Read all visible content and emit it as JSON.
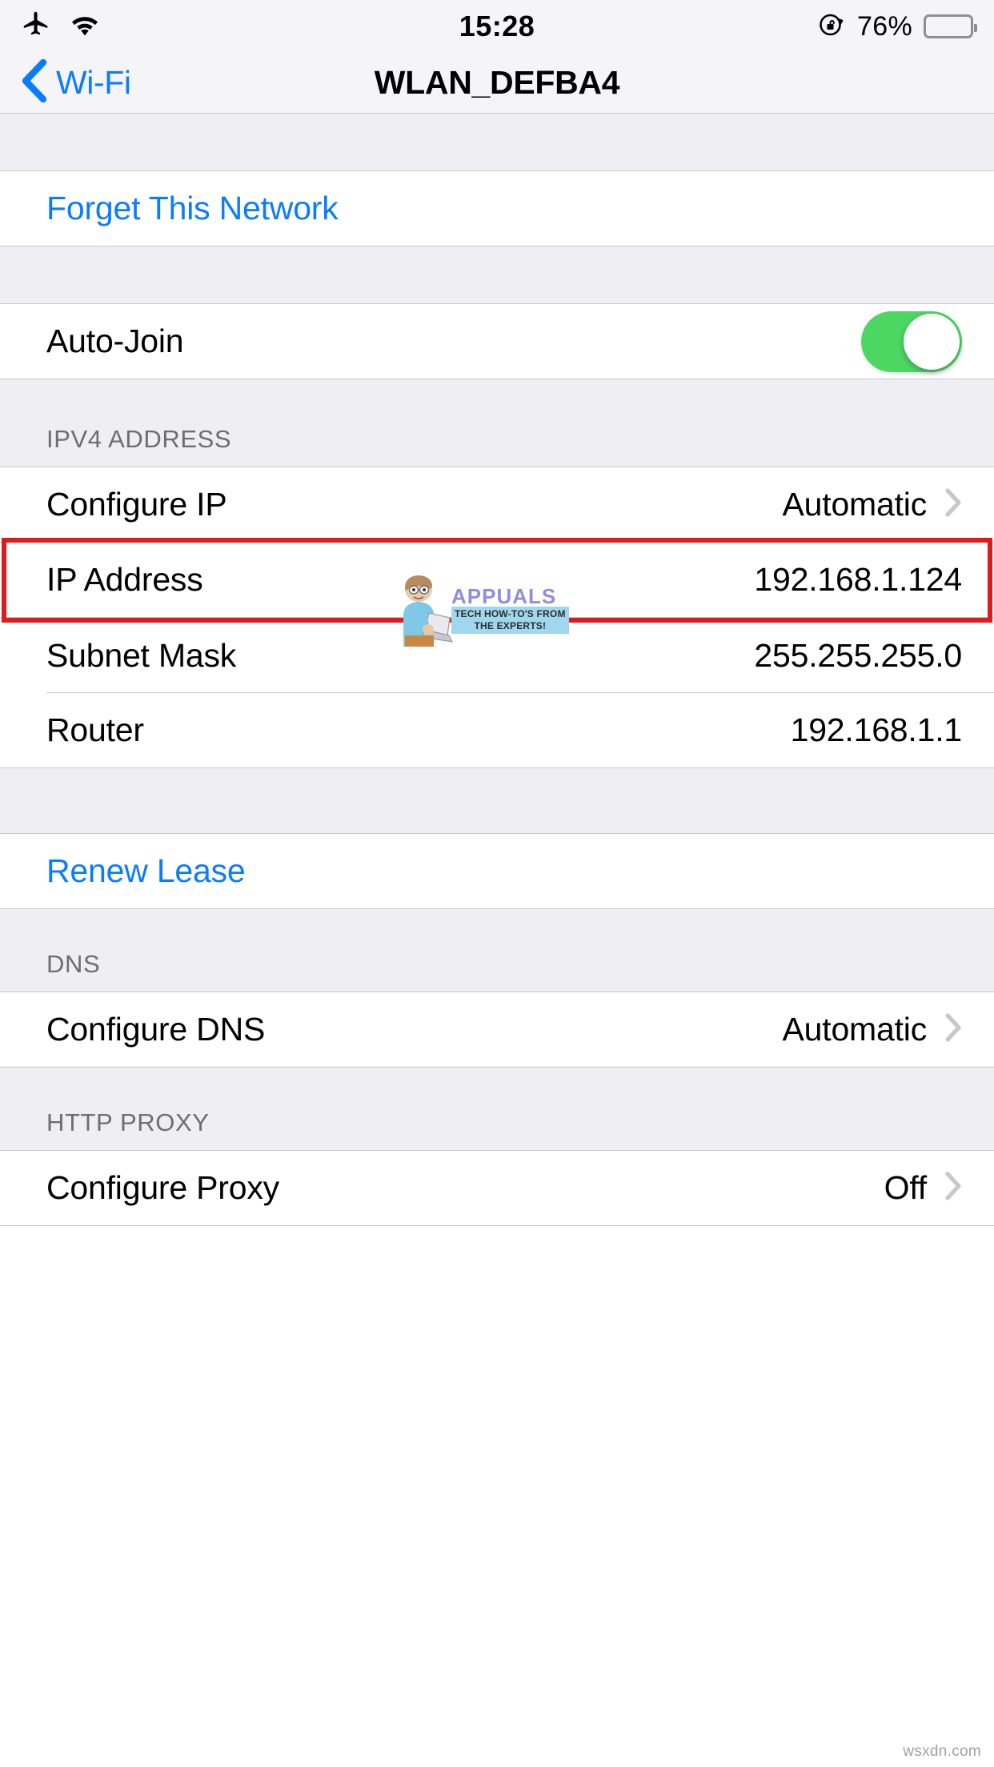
{
  "status_bar": {
    "airplane_icon": "airplane-icon",
    "wifi_icon": "wifi-icon",
    "time": "15:28",
    "rotation_lock_icon": "rotation-lock-icon",
    "battery_percent": "76%",
    "battery_level": 76
  },
  "nav": {
    "back_label": "Wi-Fi",
    "back_icon": "chevron-left-icon",
    "title": "WLAN_DEFBA4"
  },
  "sections": {
    "forget": {
      "label": "Forget This Network"
    },
    "auto_join": {
      "label": "Auto-Join",
      "enabled": true
    },
    "ipv4": {
      "header": "IPV4 ADDRESS",
      "rows": [
        {
          "label": "Configure IP",
          "value": "Automatic",
          "chevron": true
        },
        {
          "label": "IP Address",
          "value": "192.168.1.124",
          "chevron": false
        },
        {
          "label": "Subnet Mask",
          "value": "255.255.255.0",
          "chevron": false
        },
        {
          "label": "Router",
          "value": "192.168.1.1",
          "chevron": false
        }
      ]
    },
    "renew": {
      "label": "Renew Lease"
    },
    "dns": {
      "header": "DNS",
      "rows": [
        {
          "label": "Configure DNS",
          "value": "Automatic",
          "chevron": true
        }
      ]
    },
    "proxy": {
      "header": "HTTP PROXY",
      "rows": [
        {
          "label": "Configure Proxy",
          "value": "Off",
          "chevron": true
        }
      ]
    }
  },
  "annotation": {
    "highlight_color": "#E01B1B",
    "highlighted_row": "IP Address"
  },
  "watermarks": {
    "brand": "APPUALS",
    "tagline_line1": "TECH HOW-TO'S FROM",
    "tagline_line2": "THE EXPERTS!",
    "site": "wsxdn.com"
  },
  "colors": {
    "accent_blue": "#0A7CFF",
    "toggle_green": "#4CD763",
    "group_bg": "#EFEEF3",
    "separator": "#C8C7CC",
    "header_text": "#6D6D72"
  }
}
